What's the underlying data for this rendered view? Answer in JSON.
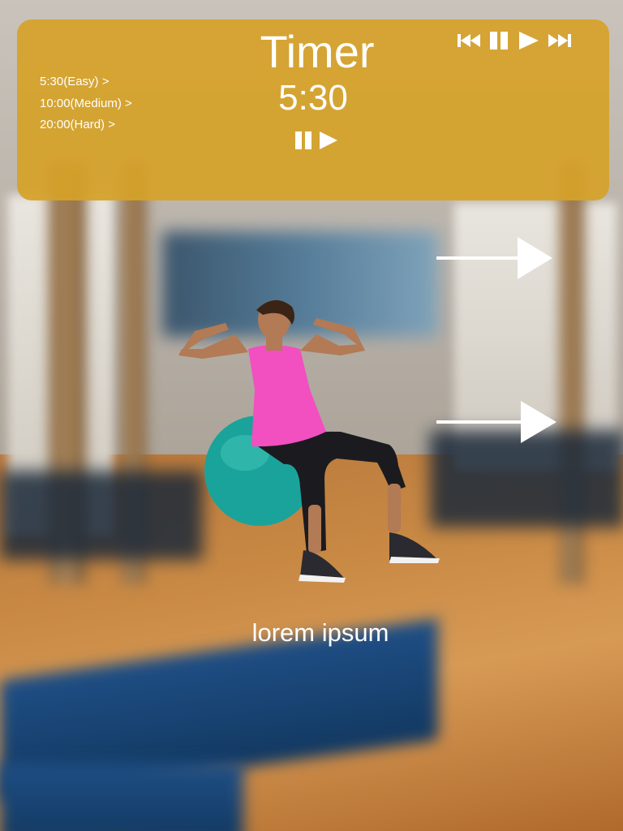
{
  "timer": {
    "title": "Timer",
    "value": "5:30",
    "levels": [
      {
        "label": "5:30(Easy) >"
      },
      {
        "label": "10:00(Medium) >"
      },
      {
        "label": "20:00(Hard) >"
      }
    ]
  },
  "media_controls": {
    "icons": [
      "skip-back-icon",
      "pause-icon",
      "play-icon",
      "fast-forward-icon"
    ]
  },
  "center_controls": {
    "icons": [
      "pause-icon",
      "play-icon"
    ]
  },
  "nav_arrows": [
    "arrow-right-icon",
    "arrow-right-icon"
  ],
  "exercise": {
    "caption": "lorem ipsum"
  },
  "colors": {
    "panel": "#d6a228",
    "text": "#ffffff",
    "ball": "#1aa39a",
    "top": "#f24fc1"
  }
}
